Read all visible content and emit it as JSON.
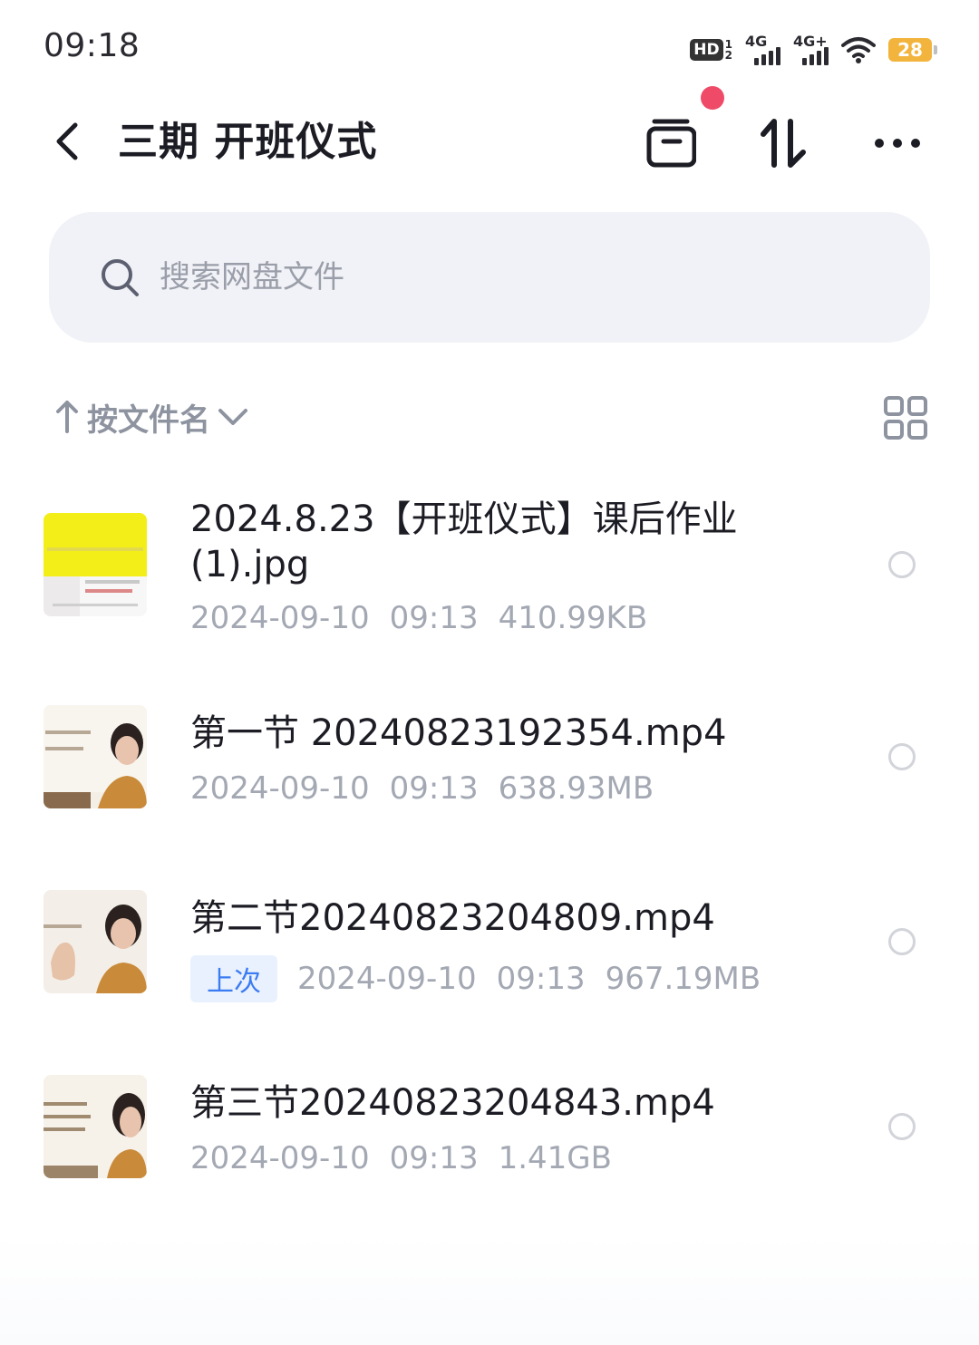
{
  "status_bar": {
    "time": "09:18",
    "hd_label": "HD",
    "hd_sub_top": "1",
    "hd_sub_bottom": "2",
    "net1": "4G",
    "net2": "4G+",
    "battery": "28"
  },
  "header": {
    "title": "三期 开班仪式",
    "back_icon": "chevron-left-icon",
    "archive_icon": "archive-box-icon",
    "sort_icon": "sort-arrows-icon",
    "more_icon": "more-dots-icon"
  },
  "search": {
    "placeholder": "搜索网盘文件"
  },
  "sort_bar": {
    "label": "按文件名"
  },
  "files": [
    {
      "name_line1": "2024.8.23【开班仪式】课后作业",
      "name_line2": "(1).jpg",
      "date": "2024-09-10",
      "time": "09:13",
      "size": "410.99KB",
      "tag": ""
    },
    {
      "name_line1": "第一节 20240823192354.mp4",
      "date": "2024-09-10",
      "time": "09:13",
      "size": "638.93MB",
      "tag": ""
    },
    {
      "name_line1": "第二节20240823204809.mp4",
      "date": "2024-09-10",
      "time": "09:13",
      "size": "967.19MB",
      "tag": "上次"
    },
    {
      "name_line1": "第三节20240823204843.mp4",
      "date": "2024-09-10",
      "time": "09:13",
      "size": "1.41GB",
      "tag": ""
    }
  ]
}
